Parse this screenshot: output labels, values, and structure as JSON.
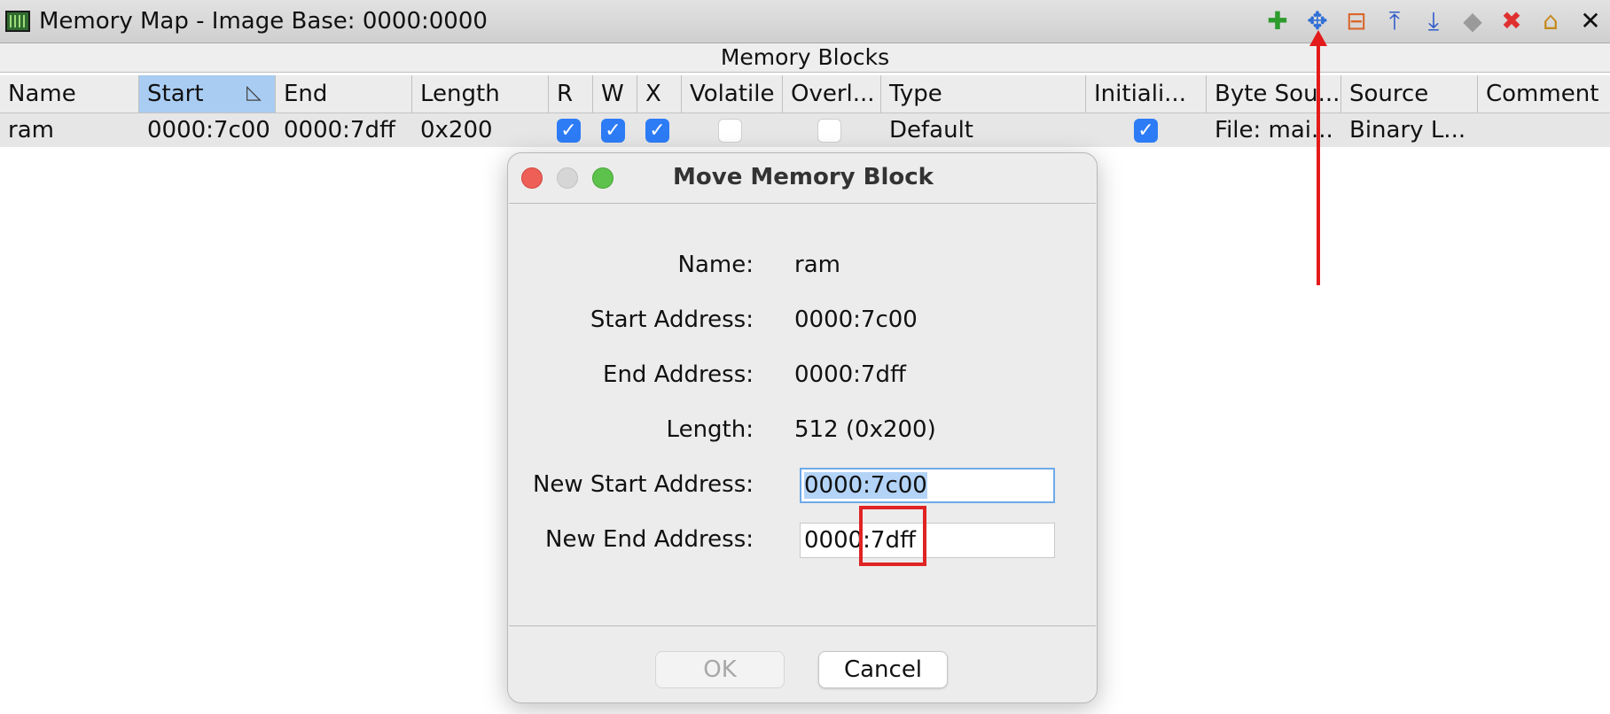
{
  "window": {
    "title": "Memory Map - Image Base: 0000:0000"
  },
  "toolbar": {
    "icons": [
      {
        "name": "add-block-icon",
        "glyph": "✚",
        "color": "#2d9b2d"
      },
      {
        "name": "move-block-icon",
        "glyph": "✥",
        "color": "#2f6fd6"
      },
      {
        "name": "split-block-icon",
        "glyph": "⊟",
        "color": "#d9662a"
      },
      {
        "name": "expand-up-icon",
        "glyph": "⤒",
        "color": "#2f5cc9"
      },
      {
        "name": "expand-down-icon",
        "glyph": "⤓",
        "color": "#2f5cc9"
      },
      {
        "name": "merge-blocks-icon",
        "glyph": "◆",
        "color": "#9a9a9a"
      },
      {
        "name": "delete-block-icon",
        "glyph": "✖",
        "color": "#e03030"
      },
      {
        "name": "set-image-base-icon",
        "glyph": "⌂",
        "color": "#c58a1f"
      },
      {
        "name": "close-icon",
        "glyph": "✕",
        "color": "#111111"
      }
    ]
  },
  "blocks": {
    "header": "Memory Blocks",
    "columns": [
      "Name",
      "Start",
      "End",
      "Length",
      "R",
      "W",
      "X",
      "Volatile",
      "Overl...",
      "Type",
      "Initiali...",
      "Byte Sou...",
      "Source",
      "Comment"
    ],
    "sorted_column": "Start",
    "rows": [
      {
        "name": "ram",
        "start": "0000:7c00",
        "end": "0000:7dff",
        "length": "0x200",
        "r": true,
        "w": true,
        "x": true,
        "volatile": false,
        "overlay": false,
        "type": "Default",
        "initialized": true,
        "byte_source": "File: mai...",
        "source": "Binary L...",
        "comment": ""
      }
    ]
  },
  "dialog": {
    "title": "Move Memory Block",
    "name_label": "Name:",
    "name_value": "ram",
    "start_label": "Start Address:",
    "start_value": "0000:7c00",
    "end_label": "End Address:",
    "end_value": "0000:7dff",
    "length_label": "Length:",
    "length_value": "512  (0x200)",
    "new_start_label": "New Start Address:",
    "new_start_value": "0000:7c00",
    "new_end_label": "New End Address:",
    "new_end_value": "0000:7dff",
    "ok_label": "OK",
    "cancel_label": "Cancel"
  },
  "colors": {
    "annotation_red": "#e31b1b",
    "selection_blue": "#a9cdf2",
    "checkbox_blue": "#2d7cf6"
  }
}
